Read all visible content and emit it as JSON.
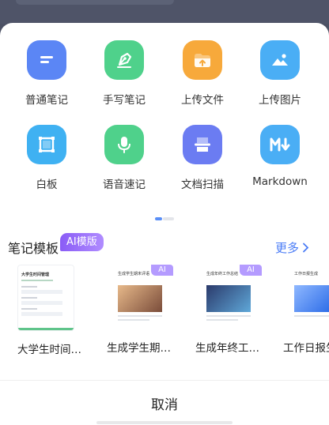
{
  "actions": [
    {
      "label": "普通笔记",
      "icon": "note-lines-icon",
      "color": "#5b86f5"
    },
    {
      "label": "手写笔记",
      "icon": "pen-nib-icon",
      "color": "#4fd18b"
    },
    {
      "label": "上传文件",
      "icon": "upload-folder-icon",
      "color": "#f7a93b"
    },
    {
      "label": "上传图片",
      "icon": "image-icon",
      "color": "#4aaef5"
    },
    {
      "label": "白板",
      "icon": "whiteboard-icon",
      "color": "#3fb1f2"
    },
    {
      "label": "语音速记",
      "icon": "microphone-icon",
      "color": "#4fd18b"
    },
    {
      "label": "文档扫描",
      "icon": "scanner-icon",
      "color": "#6b7cf2"
    },
    {
      "label": "Markdown",
      "icon": "markdown-icon",
      "color": "#4aaef5"
    }
  ],
  "pager": {
    "active_index": 0,
    "pages": 2
  },
  "templates_section": {
    "title": "笔记模板",
    "ai_badge": "AI模版",
    "more_label": "更多",
    "cards": [
      {
        "title": "大学生时间…",
        "preview_heading": "大学生时间管理",
        "ai": false
      },
      {
        "title": "生成学生期…",
        "preview_heading": "生成学生期末评语",
        "ai": true,
        "ai_label": "AI"
      },
      {
        "title": "生成年终工…",
        "preview_heading": "生成年终工作总结",
        "ai": true,
        "ai_label": "AI"
      },
      {
        "title": "工作日报生",
        "preview_heading": "工作日报生成",
        "ai": false
      }
    ]
  },
  "cancel_label": "取消",
  "colors": {
    "accent": "#4a7cf6",
    "ai_purple": "#9a6bff"
  }
}
